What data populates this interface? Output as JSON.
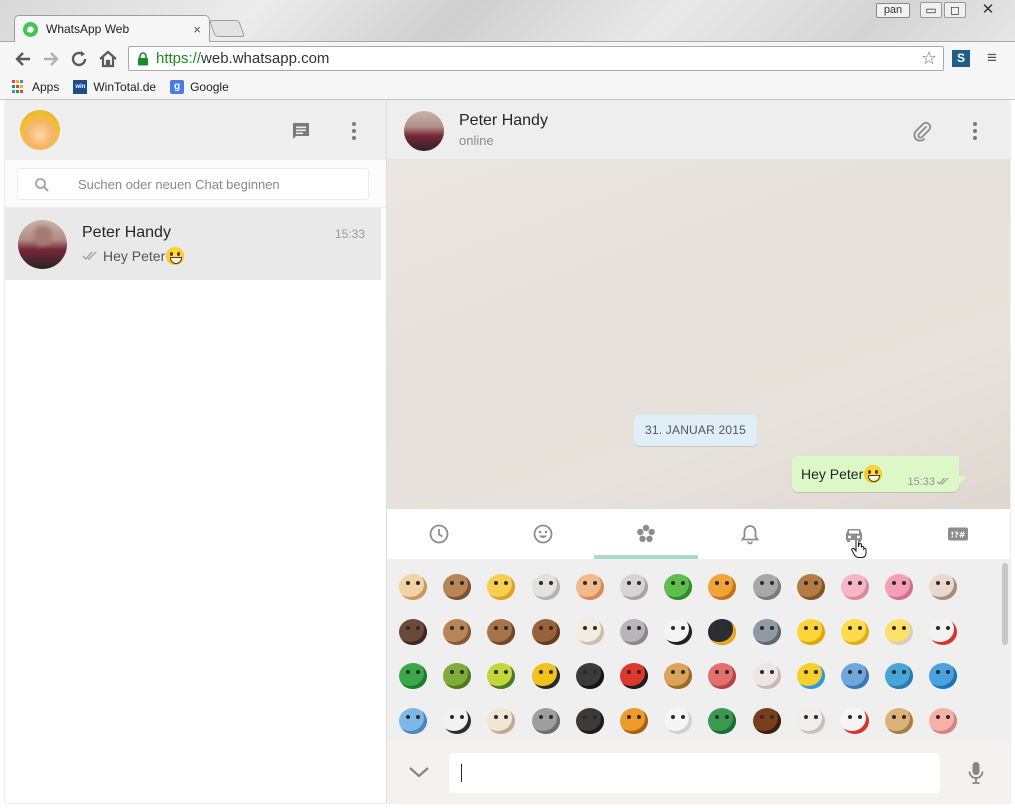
{
  "browser": {
    "tab_title": "WhatsApp Web",
    "tab_close": "×",
    "user_badge": "pan",
    "url_scheme": "https://",
    "url_rest": "web.whatsapp.com",
    "bookmarks": [
      {
        "label": "Apps",
        "icon": "apps-grid-icon"
      },
      {
        "label": "WinTotal.de",
        "icon": "wintotal-icon"
      },
      {
        "label": "Google",
        "icon": "google-icon"
      }
    ],
    "extension_label": "S",
    "google_letter": "g",
    "wintotal_text": "win"
  },
  "left": {
    "search_placeholder": "Suchen oder neuen Chat beginnen",
    "chats": [
      {
        "name": "Peter Handy",
        "time": "15:33",
        "last_message": "Hey Peter"
      }
    ]
  },
  "right": {
    "contact_name": "Peter Handy",
    "contact_status": "online",
    "date_badge": "31. JANUAR 2015",
    "messages": [
      {
        "text": "Hey Peter",
        "time": "15:33",
        "direction": "out",
        "status": "delivered"
      }
    ],
    "emoji_tabs": [
      {
        "name": "recent",
        "icon": "clock-icon"
      },
      {
        "name": "people",
        "icon": "smiley-icon"
      },
      {
        "name": "nature",
        "icon": "flower-icon",
        "active": true
      },
      {
        "name": "objects",
        "icon": "bell-icon"
      },
      {
        "name": "places",
        "icon": "car-icon"
      },
      {
        "name": "symbols",
        "icon": "symbols-icon",
        "label": "!?#"
      }
    ],
    "emoji_rows": [
      [
        "dog",
        "wolf",
        "cat",
        "mouse",
        "hamster",
        "rabbit",
        "frog",
        "tiger",
        "koala",
        "bear",
        "pig",
        "pig-nose",
        "cow"
      ],
      [
        "boar",
        "monkey",
        "monkey-2",
        "horse",
        "sheep",
        "elephant",
        "panda",
        "penguin",
        "bird",
        "chick",
        "baby-chick",
        "hatching-chick",
        "chicken"
      ],
      [
        "snake",
        "turtle",
        "bug",
        "bee",
        "ant",
        "ladybug",
        "snail",
        "octopus",
        "shell",
        "tropical-fish",
        "fish",
        "dolphin",
        "whale"
      ],
      [
        "whale-2",
        "cow-2",
        "ram",
        "rat",
        "water-buffalo",
        "tiger-2",
        "rabbit-2",
        "dragon",
        "racehorse",
        "goat",
        "rooster",
        "dog-2",
        "pig-2"
      ]
    ],
    "composer_value": ""
  },
  "colors": {
    "accent_tab_underline": "#a7d8d1",
    "outgoing_bubble": "#dcf8c6",
    "date_badge_bg": "#dfeef7",
    "selected_chat_bg": "#e9e9ea",
    "header_bg": "#eeeeee"
  }
}
